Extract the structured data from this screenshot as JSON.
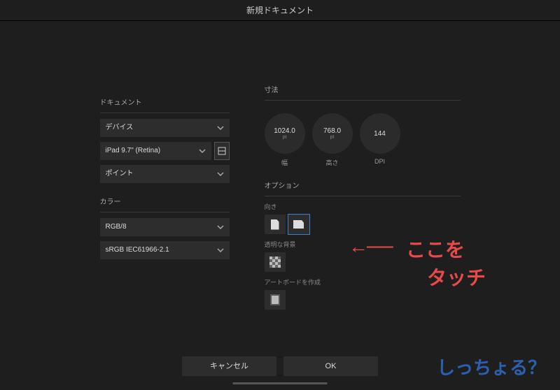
{
  "title": "新規ドキュメント",
  "left": {
    "doc_label": "ドキュメント",
    "type": "デバイス",
    "device": "iPad 9.7\" (Retina)",
    "unit": "ポイント",
    "color_label": "カラー",
    "color_fmt": "RGB/8",
    "color_profile": "sRGB IEC61966-2.1"
  },
  "right": {
    "dims_label": "寸法",
    "width_val": "1024.0",
    "width_unit": "pt",
    "width_caption": "幅",
    "height_val": "768.0",
    "height_unit": "pt",
    "height_caption": "高さ",
    "dpi_val": "144",
    "dpi_caption": "DPI",
    "options_label": "オプション",
    "orientation_label": "向き",
    "transparent_bg_label": "透明な背景",
    "artboard_label": "アートボードを作成"
  },
  "footer": {
    "cancel": "キャンセル",
    "ok": "OK"
  },
  "annotation": {
    "arrow": "←──",
    "text1": "ここを",
    "text2": "タッチ",
    "watermark": "しっちょる？"
  }
}
